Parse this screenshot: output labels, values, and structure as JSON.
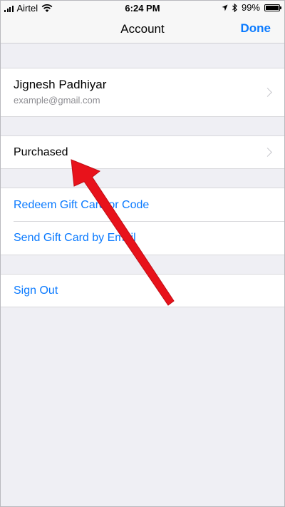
{
  "status_bar": {
    "carrier": "Airtel",
    "time": "6:24 PM",
    "battery": "99%",
    "battery_level": 0.99,
    "icons": [
      "signal-icon",
      "wifi-icon",
      "location-icon",
      "bluetooth-icon",
      "battery-icon"
    ]
  },
  "nav": {
    "title": "Account",
    "done_label": "Done"
  },
  "profile": {
    "name": "Jignesh Padhiyar",
    "email": "example@gmail.com"
  },
  "purchased": {
    "label": "Purchased"
  },
  "gift": {
    "redeem_label": "Redeem Gift Card or Code",
    "send_label": "Send Gift Card by Email"
  },
  "sign_out": {
    "label": "Sign Out"
  },
  "colors": {
    "accent": "#0a7aff",
    "annotation_arrow": "#e8121b",
    "background": "#efeff4"
  }
}
